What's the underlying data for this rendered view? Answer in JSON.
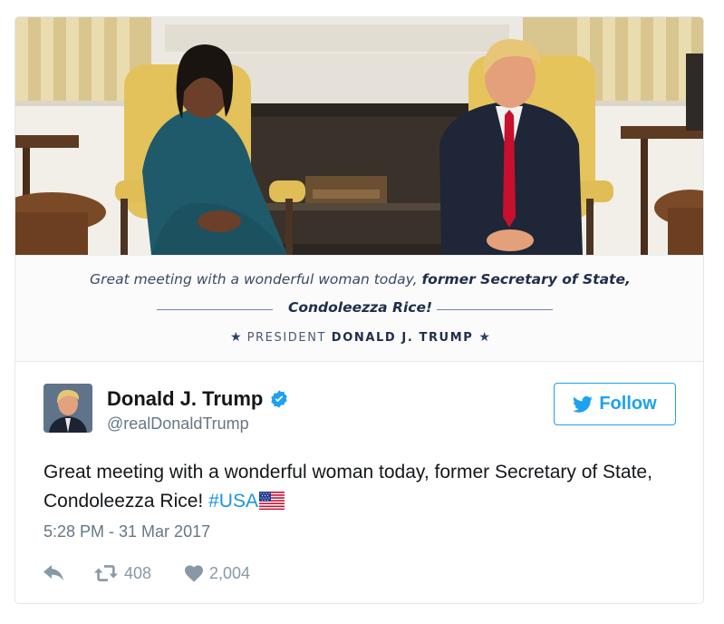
{
  "media": {
    "caption_regular": "Great meeting with a wonderful woman today, ",
    "caption_bold": "former Secretary of State,",
    "caption_line2": "Condoleezza Rice!",
    "signature_prefix": "PRESIDENT ",
    "signature_name": "DONALD J. TRUMP",
    "star": "★"
  },
  "author": {
    "name": "Donald J. Trump",
    "handle": "@realDonaldTrump",
    "verified_icon": "verified-badge-icon"
  },
  "follow_button": {
    "label": "Follow",
    "icon": "twitter-bird-icon"
  },
  "tweet": {
    "text": "Great meeting with a wonderful woman today, former Secretary of State, Condoleezza Rice! ",
    "hashtag": "#USA",
    "emoji": "us-flag-emoji",
    "timestamp": "5:28 PM - 31 Mar 2017"
  },
  "actions": {
    "reply_icon": "reply-icon",
    "retweet_icon": "retweet-icon",
    "retweet_count": "408",
    "like_icon": "heart-icon",
    "like_count": "2,004"
  },
  "colors": {
    "accent": "#1da1f2",
    "hashtag": "#1b95e0",
    "secondary_text": "#657786",
    "action_gray": "#8899a6"
  }
}
